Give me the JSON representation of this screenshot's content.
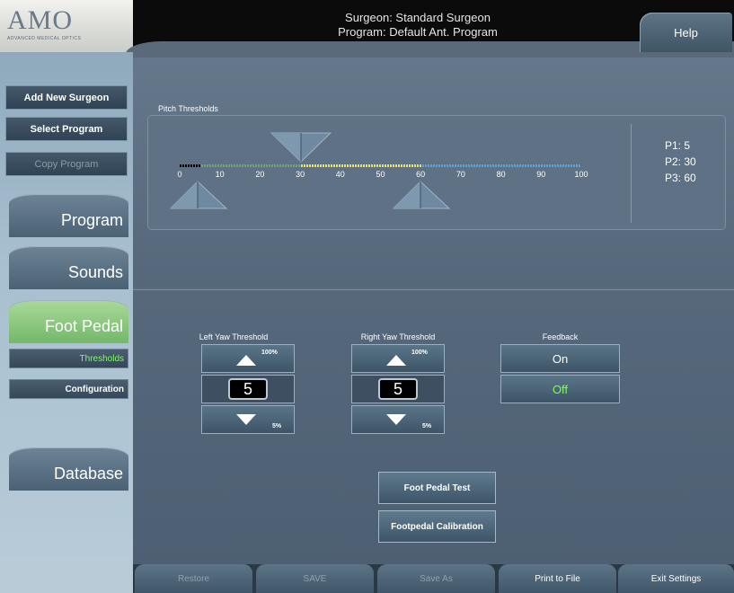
{
  "logo": {
    "text": "AMO",
    "sub": "ADVANCED MEDICAL OPTICS"
  },
  "header": {
    "surgeon_line": "Surgeon: Standard Surgeon",
    "program_line": "Program: Default Ant. Program",
    "help_label": "Help"
  },
  "sidebar": {
    "add_surgeon": "Add New Surgeon",
    "select_program": "Select Program",
    "copy_program": "Copy Program",
    "program": "Program",
    "sounds": "Sounds",
    "foot_pedal": "Foot Pedal",
    "thresholds": "Thresholds",
    "configuration": "Configuration",
    "database": "Database"
  },
  "pitch": {
    "title": "Pitch Thresholds",
    "ticks": [
      "0",
      "10",
      "20",
      "30",
      "40",
      "50",
      "60",
      "70",
      "80",
      "90",
      "100"
    ],
    "p1": "P1: 5",
    "p2": "P2: 30",
    "p3": "P3: 60",
    "p1_value": 5,
    "p2_value": 30,
    "p3_value": 60,
    "colors": {
      "segment0": "#000000",
      "segment1": "#6ea85a",
      "segment2": "#f0e640",
      "segment3": "#4aa8e8"
    }
  },
  "left_yaw": {
    "label": "Left Yaw Threshold",
    "max": "100%",
    "value": "5",
    "min": "5%"
  },
  "right_yaw": {
    "label": "Right Yaw Threshold",
    "max": "100%",
    "value": "5",
    "min": "5%"
  },
  "feedback": {
    "label": "Feedback",
    "on": "On",
    "off": "Off",
    "selected": "Off",
    "selected_color": "#7dff5a"
  },
  "actions": {
    "foot_pedal_test": "Foot Pedal Test",
    "footpedal_calibration": "Footpedal Calibration"
  },
  "bottom": {
    "restore": "Restore",
    "save": "SAVE",
    "save_as": "Save As",
    "print": "Print to File",
    "exit": "Exit Settings"
  }
}
